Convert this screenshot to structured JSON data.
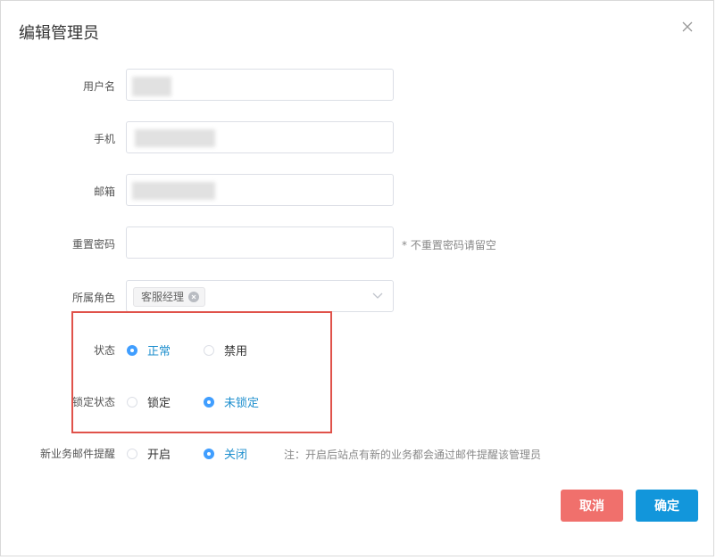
{
  "dialog": {
    "title": "编辑管理员",
    "close_icon": "close-icon"
  },
  "form": {
    "username": {
      "label": "用户名",
      "value": ""
    },
    "phone": {
      "label": "手机",
      "value": ""
    },
    "email": {
      "label": "邮箱",
      "value": ""
    },
    "reset_password": {
      "label": "重置密码",
      "value": "",
      "hint": "* 不重置密码请留空"
    },
    "role": {
      "label": "所属角色",
      "selected_tag": "客服经理"
    },
    "status": {
      "label": "状态",
      "options": [
        {
          "label": "正常",
          "checked": true
        },
        {
          "label": "禁用",
          "checked": false
        }
      ]
    },
    "lock_status": {
      "label": "锁定状态",
      "options": [
        {
          "label": "锁定",
          "checked": false
        },
        {
          "label": "未锁定",
          "checked": true
        }
      ]
    },
    "email_notify": {
      "label": "新业务邮件提醒",
      "options": [
        {
          "label": "开启",
          "checked": false
        },
        {
          "label": "关闭",
          "checked": true
        }
      ],
      "note": "注：开启后站点有新的业务都会通过邮件提醒该管理员"
    }
  },
  "buttons": {
    "cancel": "取消",
    "confirm": "确定"
  },
  "colors": {
    "accent": "#409eff",
    "checked_text": "#1e8fce",
    "cancel_bg": "#f0706c",
    "confirm_bg": "#1296db",
    "highlight": "#e0524a"
  }
}
